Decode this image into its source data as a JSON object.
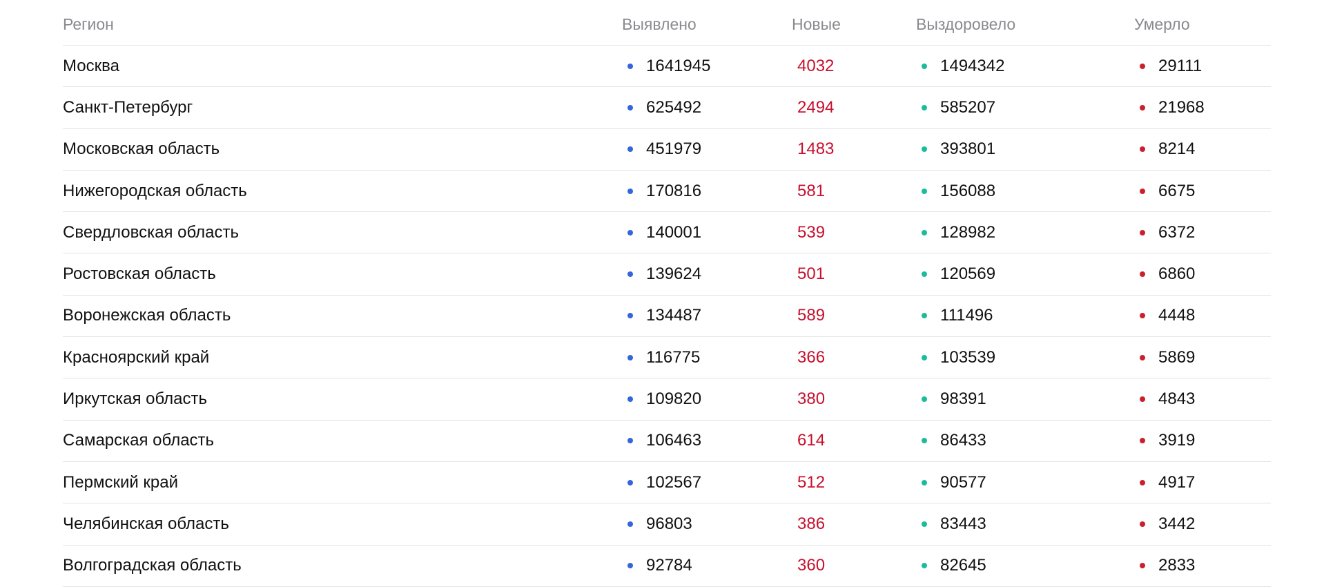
{
  "colors": {
    "detected_dot": "#3366dd",
    "recovered_dot": "#1abc9c",
    "died_dot": "#cc1f2e",
    "new_text": "#c8102e",
    "header_text": "#8a8a8f",
    "divider": "#e3e3e3"
  },
  "table": {
    "headers": {
      "region": "Регион",
      "detected": "Выявлено",
      "new": "Новые",
      "recovered": "Выздоровело",
      "died": "Умерло"
    },
    "rows": [
      {
        "region": "Москва",
        "detected": "1641945",
        "new": "4032",
        "recovered": "1494342",
        "died": "29111"
      },
      {
        "region": "Санкт-Петербург",
        "detected": "625492",
        "new": "2494",
        "recovered": "585207",
        "died": "21968"
      },
      {
        "region": "Московская область",
        "detected": "451979",
        "new": "1483",
        "recovered": "393801",
        "died": "8214"
      },
      {
        "region": "Нижегородская область",
        "detected": "170816",
        "new": "581",
        "recovered": "156088",
        "died": "6675"
      },
      {
        "region": "Свердловская область",
        "detected": "140001",
        "new": "539",
        "recovered": "128982",
        "died": "6372"
      },
      {
        "region": "Ростовская область",
        "detected": "139624",
        "new": "501",
        "recovered": "120569",
        "died": "6860"
      },
      {
        "region": "Воронежская область",
        "detected": "134487",
        "new": "589",
        "recovered": "111496",
        "died": "4448"
      },
      {
        "region": "Красноярский край",
        "detected": "116775",
        "new": "366",
        "recovered": "103539",
        "died": "5869"
      },
      {
        "region": "Иркутская область",
        "detected": "109820",
        "new": "380",
        "recovered": "98391",
        "died": "4843"
      },
      {
        "region": "Самарская область",
        "detected": "106463",
        "new": "614",
        "recovered": "86433",
        "died": "3919"
      },
      {
        "region": "Пермский край",
        "detected": "102567",
        "new": "512",
        "recovered": "90577",
        "died": "4917"
      },
      {
        "region": "Челябинская область",
        "detected": "96803",
        "new": "386",
        "recovered": "83443",
        "died": "3442"
      },
      {
        "region": "Волгоградская область",
        "detected": "92784",
        "new": "360",
        "recovered": "82645",
        "died": "2833"
      }
    ]
  }
}
